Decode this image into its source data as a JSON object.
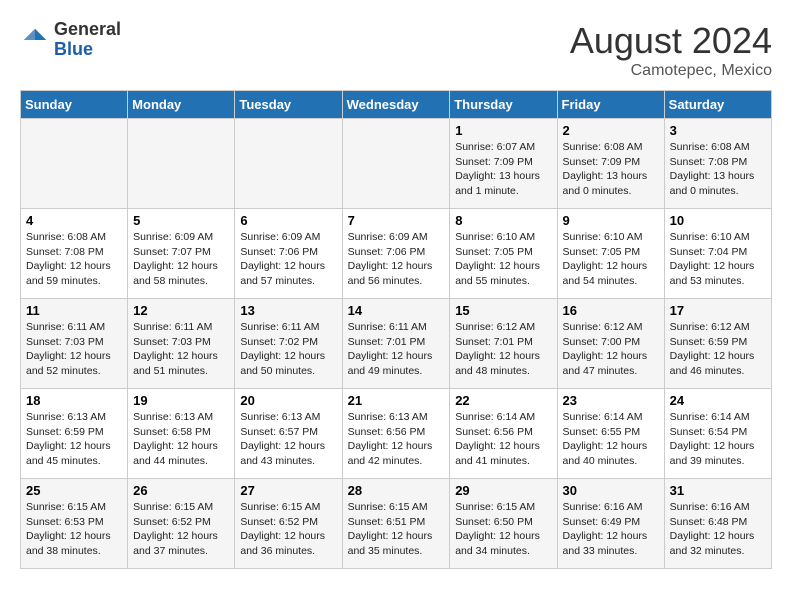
{
  "header": {
    "logo_general": "General",
    "logo_blue": "Blue",
    "month_year": "August 2024",
    "location": "Camotepec, Mexico"
  },
  "weekdays": [
    "Sunday",
    "Monday",
    "Tuesday",
    "Wednesday",
    "Thursday",
    "Friday",
    "Saturday"
  ],
  "weeks": [
    [
      {
        "day": "",
        "info": ""
      },
      {
        "day": "",
        "info": ""
      },
      {
        "day": "",
        "info": ""
      },
      {
        "day": "",
        "info": ""
      },
      {
        "day": "1",
        "info": "Sunrise: 6:07 AM\nSunset: 7:09 PM\nDaylight: 13 hours\nand 1 minute."
      },
      {
        "day": "2",
        "info": "Sunrise: 6:08 AM\nSunset: 7:09 PM\nDaylight: 13 hours\nand 0 minutes."
      },
      {
        "day": "3",
        "info": "Sunrise: 6:08 AM\nSunset: 7:08 PM\nDaylight: 13 hours\nand 0 minutes."
      }
    ],
    [
      {
        "day": "4",
        "info": "Sunrise: 6:08 AM\nSunset: 7:08 PM\nDaylight: 12 hours\nand 59 minutes."
      },
      {
        "day": "5",
        "info": "Sunrise: 6:09 AM\nSunset: 7:07 PM\nDaylight: 12 hours\nand 58 minutes."
      },
      {
        "day": "6",
        "info": "Sunrise: 6:09 AM\nSunset: 7:06 PM\nDaylight: 12 hours\nand 57 minutes."
      },
      {
        "day": "7",
        "info": "Sunrise: 6:09 AM\nSunset: 7:06 PM\nDaylight: 12 hours\nand 56 minutes."
      },
      {
        "day": "8",
        "info": "Sunrise: 6:10 AM\nSunset: 7:05 PM\nDaylight: 12 hours\nand 55 minutes."
      },
      {
        "day": "9",
        "info": "Sunrise: 6:10 AM\nSunset: 7:05 PM\nDaylight: 12 hours\nand 54 minutes."
      },
      {
        "day": "10",
        "info": "Sunrise: 6:10 AM\nSunset: 7:04 PM\nDaylight: 12 hours\nand 53 minutes."
      }
    ],
    [
      {
        "day": "11",
        "info": "Sunrise: 6:11 AM\nSunset: 7:03 PM\nDaylight: 12 hours\nand 52 minutes."
      },
      {
        "day": "12",
        "info": "Sunrise: 6:11 AM\nSunset: 7:03 PM\nDaylight: 12 hours\nand 51 minutes."
      },
      {
        "day": "13",
        "info": "Sunrise: 6:11 AM\nSunset: 7:02 PM\nDaylight: 12 hours\nand 50 minutes."
      },
      {
        "day": "14",
        "info": "Sunrise: 6:11 AM\nSunset: 7:01 PM\nDaylight: 12 hours\nand 49 minutes."
      },
      {
        "day": "15",
        "info": "Sunrise: 6:12 AM\nSunset: 7:01 PM\nDaylight: 12 hours\nand 48 minutes."
      },
      {
        "day": "16",
        "info": "Sunrise: 6:12 AM\nSunset: 7:00 PM\nDaylight: 12 hours\nand 47 minutes."
      },
      {
        "day": "17",
        "info": "Sunrise: 6:12 AM\nSunset: 6:59 PM\nDaylight: 12 hours\nand 46 minutes."
      }
    ],
    [
      {
        "day": "18",
        "info": "Sunrise: 6:13 AM\nSunset: 6:59 PM\nDaylight: 12 hours\nand 45 minutes."
      },
      {
        "day": "19",
        "info": "Sunrise: 6:13 AM\nSunset: 6:58 PM\nDaylight: 12 hours\nand 44 minutes."
      },
      {
        "day": "20",
        "info": "Sunrise: 6:13 AM\nSunset: 6:57 PM\nDaylight: 12 hours\nand 43 minutes."
      },
      {
        "day": "21",
        "info": "Sunrise: 6:13 AM\nSunset: 6:56 PM\nDaylight: 12 hours\nand 42 minutes."
      },
      {
        "day": "22",
        "info": "Sunrise: 6:14 AM\nSunset: 6:56 PM\nDaylight: 12 hours\nand 41 minutes."
      },
      {
        "day": "23",
        "info": "Sunrise: 6:14 AM\nSunset: 6:55 PM\nDaylight: 12 hours\nand 40 minutes."
      },
      {
        "day": "24",
        "info": "Sunrise: 6:14 AM\nSunset: 6:54 PM\nDaylight: 12 hours\nand 39 minutes."
      }
    ],
    [
      {
        "day": "25",
        "info": "Sunrise: 6:15 AM\nSunset: 6:53 PM\nDaylight: 12 hours\nand 38 minutes."
      },
      {
        "day": "26",
        "info": "Sunrise: 6:15 AM\nSunset: 6:52 PM\nDaylight: 12 hours\nand 37 minutes."
      },
      {
        "day": "27",
        "info": "Sunrise: 6:15 AM\nSunset: 6:52 PM\nDaylight: 12 hours\nand 36 minutes."
      },
      {
        "day": "28",
        "info": "Sunrise: 6:15 AM\nSunset: 6:51 PM\nDaylight: 12 hours\nand 35 minutes."
      },
      {
        "day": "29",
        "info": "Sunrise: 6:15 AM\nSunset: 6:50 PM\nDaylight: 12 hours\nand 34 minutes."
      },
      {
        "day": "30",
        "info": "Sunrise: 6:16 AM\nSunset: 6:49 PM\nDaylight: 12 hours\nand 33 minutes."
      },
      {
        "day": "31",
        "info": "Sunrise: 6:16 AM\nSunset: 6:48 PM\nDaylight: 12 hours\nand 32 minutes."
      }
    ]
  ]
}
